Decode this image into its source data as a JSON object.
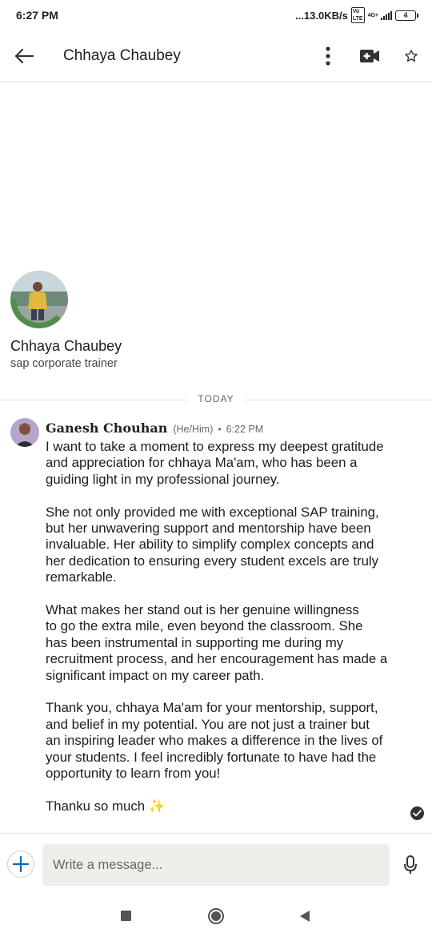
{
  "status_bar": {
    "time": "6:27 PM",
    "network_speed": "...13.0KB/s",
    "network_type": "4G+",
    "volte": "Vo LTE",
    "battery": "4"
  },
  "header": {
    "title": "Chhaya Chaubey",
    "icons": [
      "back-arrow-icon",
      "more-vertical-icon",
      "video-call-icon",
      "star-icon"
    ]
  },
  "profile": {
    "name": "Chhaya Chaubey",
    "headline": "sap corporate trainer",
    "avatar_badge": "#OPENTOWORK",
    "badge_color": "#4f8f4b"
  },
  "divider": {
    "label": "TODAY"
  },
  "message": {
    "sender": "Ganesh Chouhan",
    "pronouns": "(He/Him)",
    "separator": "•",
    "time": "6:22 PM",
    "paragraphs": [
      [
        "I want to take a moment to express my deepest gratitude",
        "and appreciation for chhaya Ma'am, who has been a",
        "guiding light in my professional journey."
      ],
      [
        "She not only provided me with exceptional SAP training,",
        "but her unwavering support and mentorship have been",
        "invaluable. Her ability to simplify complex concepts and",
        "her dedication to ensuring every student excels are truly",
        "remarkable."
      ],
      [
        "What makes her stand out is her genuine willingness",
        "to go the extra mile, even beyond the classroom. She",
        "has been instrumental in supporting me during my",
        "recruitment process, and her encouragement has made a",
        "significant impact on my career path."
      ],
      [
        "Thank you, chhaya Ma'am for your mentorship, support,",
        "and belief in my potential. You are not just a trainer but",
        "an inspiring leader who makes a difference in the lives of",
        "your students. I feel incredibly fortunate to have had the",
        "opportunity to learn from you!"
      ]
    ],
    "closing": "Thanku so much",
    "closing_emoji": "✨",
    "status_icon": "read-check-icon"
  },
  "composer": {
    "placeholder": "Write a message...",
    "accent": "#0a66c2"
  },
  "nav_bar": {
    "icons": [
      "recents-square-icon",
      "home-circle-icon",
      "back-triangle-icon"
    ]
  }
}
